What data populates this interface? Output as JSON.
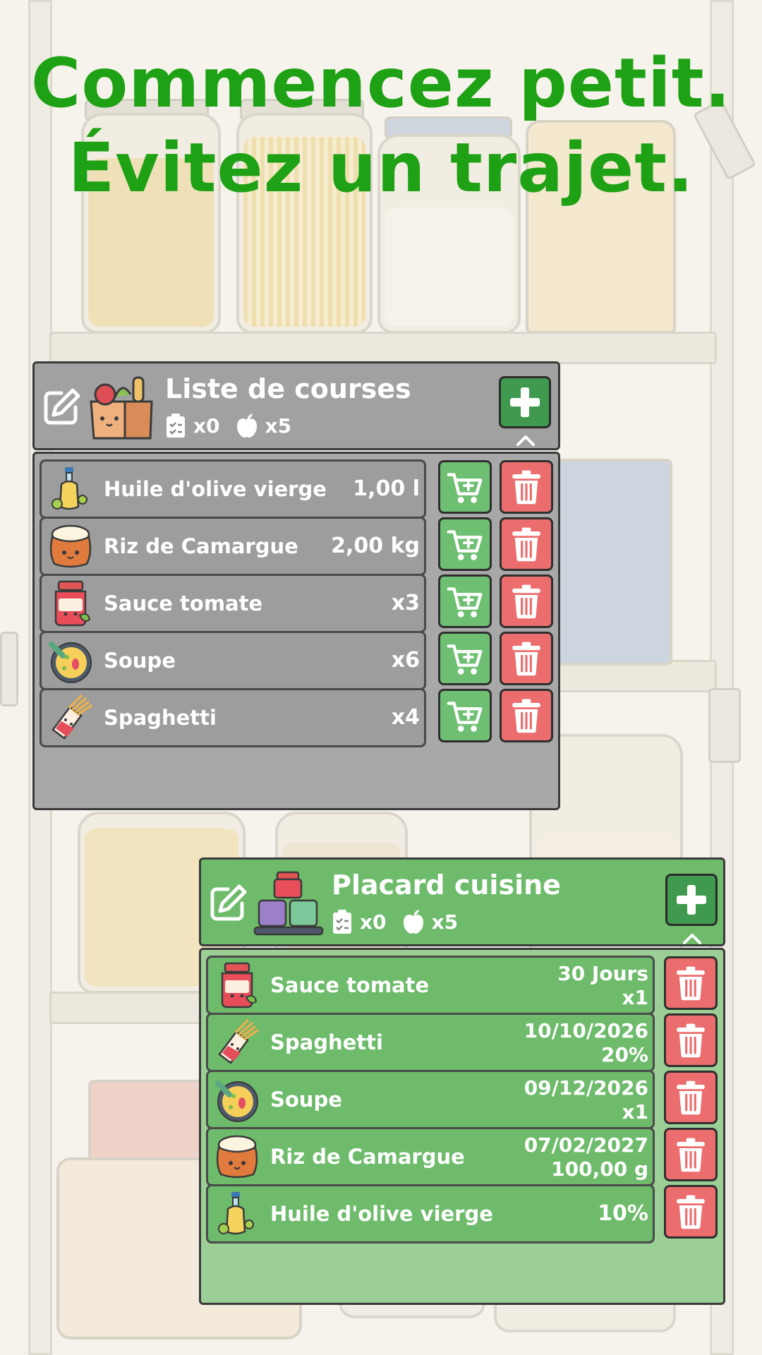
{
  "headline": {
    "line1": "Commencez petit.",
    "line2": "Évitez un trajet."
  },
  "colors": {
    "headline": "#1ea114",
    "shopping_panel": "#a1a1a1",
    "pantry_panel": "#6dbb6b",
    "cart_button": "#6fbf73",
    "delete_button": "#ec6d6d",
    "add_button": "#3f9a4f"
  },
  "shopping_list": {
    "title": "Liste de courses",
    "checklist_count": "x0",
    "items_count": "x5",
    "icon": "grocery-bag-icon",
    "items": [
      {
        "name": "Huile d'olive vierge",
        "value": "1,00 l",
        "icon": "olive-oil-bottle-icon"
      },
      {
        "name": "Riz de Camargue",
        "value": "2,00 kg",
        "icon": "rice-sack-icon"
      },
      {
        "name": "Sauce tomate",
        "value": "x3",
        "icon": "tomato-sauce-jar-icon"
      },
      {
        "name": "Soupe",
        "value": "x6",
        "icon": "soup-bowl-icon"
      },
      {
        "name": "Spaghetti",
        "value": "x4",
        "icon": "spaghetti-pack-icon"
      }
    ]
  },
  "pantry": {
    "title": "Placard cuisine",
    "checklist_count": "x0",
    "items_count": "x5",
    "icon": "jars-shelf-icon",
    "items": [
      {
        "name": "Sauce tomate",
        "line1": "30 Jours",
        "line2": "x1",
        "icon": "tomato-sauce-jar-icon"
      },
      {
        "name": "Spaghetti",
        "line1": "10/10/2026",
        "line2": "20%",
        "icon": "spaghetti-pack-icon"
      },
      {
        "name": "Soupe",
        "line1": "09/12/2026",
        "line2": "x1",
        "icon": "soup-bowl-icon"
      },
      {
        "name": "Riz de Camargue",
        "line1": "07/02/2027",
        "line2": "100,00 g",
        "icon": "rice-sack-icon"
      },
      {
        "name": "Huile d'olive vierge",
        "line1": "",
        "line2": "10%",
        "icon": "olive-oil-bottle-icon"
      }
    ]
  }
}
